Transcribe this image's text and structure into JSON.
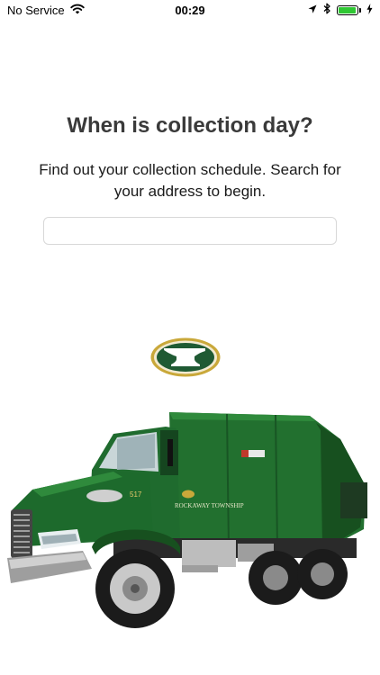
{
  "status_bar": {
    "carrier": "No Service",
    "time": "00:29",
    "battery_level": 0.95,
    "icons": [
      "wifi-icon",
      "location-arrow-icon",
      "bluetooth-icon",
      "battery-icon",
      "charging-bolt-icon"
    ]
  },
  "main": {
    "title": "When is collection day?",
    "subtitle": "Find out your collection schedule. Search for your address to begin.",
    "search": {
      "value": "",
      "placeholder": ""
    }
  },
  "logo": {
    "emblem": "anvil-emblem",
    "colors": {
      "outer_ring": "#c9a83a",
      "inner_oval": "#1f5a33",
      "anvil": "#ffffff"
    }
  },
  "truck": {
    "body_color": "#1f6b2e",
    "unit_number": "517",
    "door_text": "ROCKAWAY TOWNSHIP"
  },
  "colors": {
    "battery_green": "#2fc733",
    "title_text": "#3a3a3a",
    "input_border": "#d8d8d8"
  }
}
